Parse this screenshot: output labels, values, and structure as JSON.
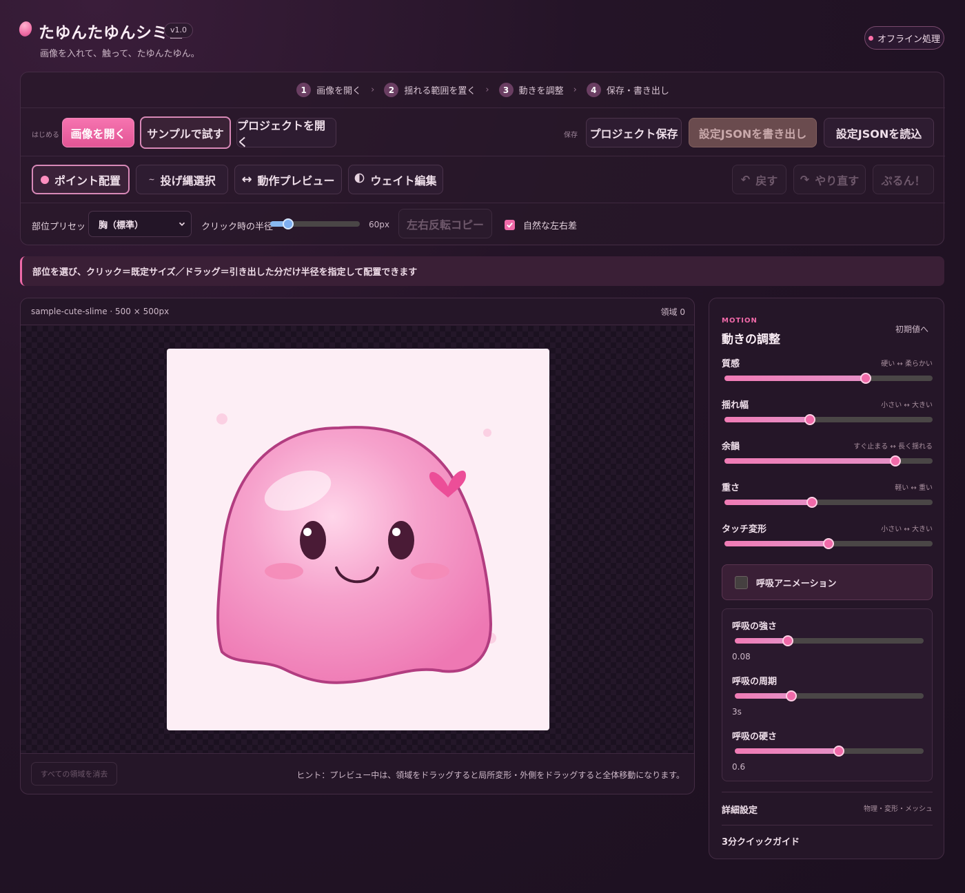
{
  "app": {
    "title": "たゆんたゆんシミュ",
    "version": "v1.0",
    "subtitle": "画像を入れて、触って、たゆんたゆん。",
    "offline_label": "オフライン処理"
  },
  "steps": [
    {
      "num": "1",
      "label": "画像を開く"
    },
    {
      "num": "2",
      "label": "揺れる範囲を置く"
    },
    {
      "num": "3",
      "label": "動きを調整"
    },
    {
      "num": "4",
      "label": "保存・書き出し"
    }
  ],
  "step_separator": "›",
  "toolbar": {
    "start_label": "はじめる",
    "open_image": "画像を開く",
    "try_sample": "サンプルで試す",
    "open_project": "プロジェクトを開く",
    "save_label": "保存",
    "save_project": "プロジェクト保存",
    "export_json": "設定JSONを書き出し",
    "import_json": "設定JSONを読込"
  },
  "modes": {
    "point_place": "ポイント配置",
    "lasso": "投げ縄選択",
    "preview": "動作プレビュー",
    "weight": "ウェイト編集",
    "undo": "戻す",
    "redo": "やり直す",
    "purun": "ぷるん！"
  },
  "options": {
    "preset_label": "部位プリセット",
    "preset_value": "胸（標準）",
    "radius_label": "クリック時の半径",
    "radius_value": "60px",
    "radius_fraction": 0.2,
    "mirror_copy": "左右反転コピー",
    "natural_diff": "自然な左右差",
    "natural_diff_checked": true
  },
  "hint": "部位を選び、クリック＝既定サイズ／ドラッグ＝引き出した分だけ半径を指定して配置できます",
  "canvas": {
    "file_info": "sample-cute-slime · 500 × 500px",
    "region_count": "領域 0",
    "clear_all": "すべての領域を消去",
    "foot_hint": "ヒント：プレビュー中は、領域をドラッグすると局所変形・外側をドラッグすると全体移動になります。"
  },
  "motion": {
    "tag": "MOTION",
    "title": "動きの調整",
    "reset": "初期値へ",
    "params": [
      {
        "label": "質感",
        "hint": "硬い ↔ 柔らかい",
        "value": 0.68
      },
      {
        "label": "揺れ幅",
        "hint": "小さい ↔ 大きい",
        "value": 0.41
      },
      {
        "label": "余韻",
        "hint": "すぐ止まる ↔ 長く揺れる",
        "value": 0.82
      },
      {
        "label": "重さ",
        "hint": "軽い ↔ 重い",
        "value": 0.42
      },
      {
        "label": "タッチ変形",
        "hint": "小さい ↔ 大きい",
        "value": 0.5
      }
    ],
    "breath_toggle": "呼吸アニメーション",
    "breath_checked": false,
    "breath_params": [
      {
        "label": "呼吸の強さ",
        "value_text": "0.08",
        "value": 0.28
      },
      {
        "label": "呼吸の周期",
        "value_text": "3s",
        "value": 0.3
      },
      {
        "label": "呼吸の硬さ",
        "value_text": "0.6",
        "value": 0.55
      }
    ],
    "advanced": "詳細設定",
    "advanced_hint": "物理・変形・メッシュ",
    "quick_guide": "3分クイックガイド"
  },
  "colors": {
    "accent": "#f06aa9",
    "background": "#1c1020"
  }
}
